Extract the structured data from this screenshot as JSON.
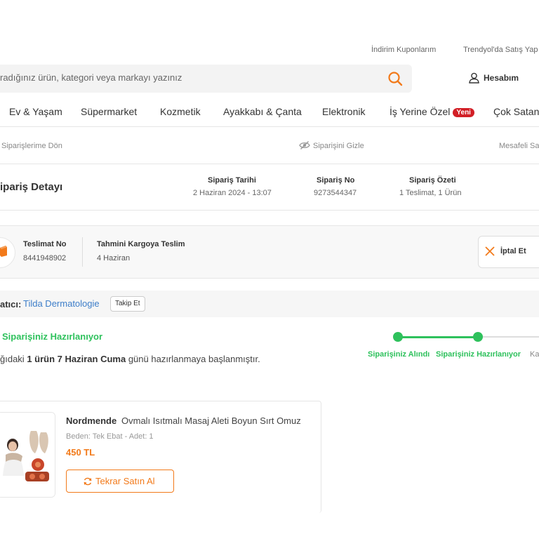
{
  "top_links": {
    "coupons": "İndirim Kuponlarım",
    "sell": "Trendyol'da Satış Yap"
  },
  "search": {
    "placeholder": "radığınız ürün, kategori veya markayı yazınız",
    "icon": "search-icon"
  },
  "account": {
    "label": "Hesabım",
    "icon": "user-icon"
  },
  "nav": {
    "items": [
      "Ev & Yaşam",
      "Süpermarket",
      "Kozmetik",
      "Ayakkabı & Çanta",
      "Elektronik",
      "İş Yerine Özel",
      "Çok Satanl"
    ],
    "new_badge": "Yeni"
  },
  "subbar": {
    "back": "Siparişlerime Dön",
    "hide": "Siparişini Gizle",
    "contract": "Mesafeli Sa"
  },
  "order": {
    "title": "ipariş Detayı",
    "date_label": "Sipariş Tarihi",
    "date_value": "2 Haziran 2024 - 13:07",
    "no_label": "Sipariş No",
    "no_value": "9273544347",
    "summary_label": "Sipariş Özeti",
    "summary_value": "1 Teslimat, 1 Ürün"
  },
  "shipment": {
    "no_label": "Teslimat No",
    "no_value": "8441948902",
    "eta_label": "Tahmini Kargoya Teslim",
    "eta_value": "4 Haziran",
    "cancel_label": "İptal Et"
  },
  "seller": {
    "label": "atıcı:",
    "name": "Tilda Dermatologie",
    "follow": "Takip Et"
  },
  "status": {
    "title": "Siparişiniz Hazırlanıyor",
    "desc_pre": "ğıdaki ",
    "desc_count": "1 ürün",
    "desc_mid": " ",
    "desc_date": "7 Haziran Cuma",
    "desc_post": " günü hazırlanmaya başlanmıştır."
  },
  "progress": {
    "steps": [
      "Siparişiniz Alındı",
      "Siparişiniz Hazırlanıyor",
      "Ka"
    ],
    "completed": 2
  },
  "product": {
    "brand": "Nordmende",
    "name": "Ovmalı Isıtmalı Masaj Aleti Boyun Sırt Omuz",
    "meta": "Beden: Tek Ebat - Adet: 1",
    "price": "450 TL",
    "rebuy": "Tekrar Satın Al"
  },
  "colors": {
    "brand": "#f27a1a",
    "success": "#2ec15c",
    "link": "#3d7ec9",
    "badge": "#d21f26"
  }
}
